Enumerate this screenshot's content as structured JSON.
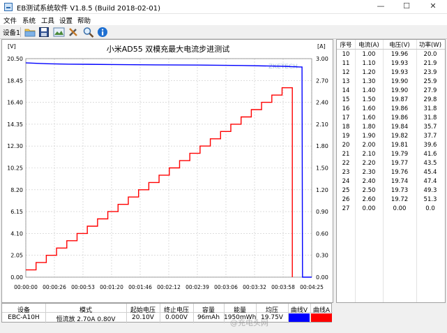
{
  "window": {
    "title": "EB测试系统软件 V1.8.5 (Build 2018-02-01)",
    "min_glyph": "—",
    "max_glyph": "☐",
    "close_glyph": "✕"
  },
  "menu": [
    "文件",
    "系统",
    "工具",
    "设置",
    "帮助"
  ],
  "toolbar": {
    "device_label": "设备1",
    "buttons": [
      "open-folder",
      "save",
      "chart-image",
      "tools",
      "search",
      "info"
    ]
  },
  "chart_data": {
    "type": "line",
    "title": "小米AD55 双模充最大电流步进测试",
    "left_axis_unit": "[V]",
    "right_axis_unit": "[A]",
    "watermark": "ZKETECH",
    "ylim_left": [
      0,
      20.5
    ],
    "ylim_right": [
      0,
      3.0
    ],
    "yticks_left": [
      "20.50",
      "18.45",
      "16.40",
      "14.35",
      "12.30",
      "10.25",
      "8.20",
      "6.15",
      "4.10",
      "2.05",
      "0.00"
    ],
    "yticks_right": [
      "3.00",
      "2.70",
      "2.40",
      "2.10",
      "1.80",
      "1.50",
      "1.20",
      "0.90",
      "0.60",
      "0.30",
      "0.00"
    ],
    "xticks": [
      "00:00:00",
      "00:00:26",
      "00:00:53",
      "00:01:20",
      "00:01:46",
      "00:02:12",
      "00:02:39",
      "00:03:06",
      "00:03:32",
      "00:03:58",
      "00:04:25"
    ],
    "x_end_seconds": 265,
    "series": [
      {
        "name": "曲线V",
        "color": "#0000ff",
        "axis": "left",
        "points": [
          [
            0,
            20.1
          ],
          [
            20,
            20.02
          ],
          [
            40,
            19.98
          ],
          [
            80,
            19.95
          ],
          [
            120,
            19.92
          ],
          [
            160,
            19.9
          ],
          [
            200,
            19.86
          ],
          [
            240,
            19.78
          ],
          [
            254,
            19.72
          ],
          [
            256,
            19.72
          ],
          [
            256.5,
            0.0
          ],
          [
            265,
            0.0
          ]
        ]
      },
      {
        "name": "曲线A",
        "color": "#ff0000",
        "axis": "right",
        "step_seconds": 9.5,
        "currents": [
          0.1,
          0.2,
          0.3,
          0.4,
          0.5,
          0.6,
          0.7,
          0.8,
          0.9,
          1.0,
          1.1,
          1.2,
          1.3,
          1.4,
          1.5,
          1.6,
          1.7,
          1.8,
          1.9,
          2.0,
          2.1,
          2.2,
          2.3,
          2.4,
          2.5,
          2.6
        ],
        "final_current": 0.0
      }
    ]
  },
  "table": {
    "headers": [
      "序号",
      "电流(A)",
      "电压(V)",
      "功率(W)"
    ],
    "rows": [
      [
        "10",
        "1.00",
        "19.96",
        "20.0"
      ],
      [
        "11",
        "1.10",
        "19.93",
        "21.9"
      ],
      [
        "12",
        "1.20",
        "19.93",
        "23.9"
      ],
      [
        "13",
        "1.30",
        "19.90",
        "25.9"
      ],
      [
        "14",
        "1.40",
        "19.90",
        "27.9"
      ],
      [
        "15",
        "1.50",
        "19.87",
        "29.8"
      ],
      [
        "16",
        "1.60",
        "19.86",
        "31.8"
      ],
      [
        "17",
        "1.60",
        "19.86",
        "31.8"
      ],
      [
        "18",
        "1.80",
        "19.84",
        "35.7"
      ],
      [
        "19",
        "1.90",
        "19.82",
        "37.7"
      ],
      [
        "20",
        "2.00",
        "19.81",
        "39.6"
      ],
      [
        "21",
        "2.10",
        "19.79",
        "41.6"
      ],
      [
        "22",
        "2.20",
        "19.77",
        "43.5"
      ],
      [
        "23",
        "2.30",
        "19.76",
        "45.4"
      ],
      [
        "24",
        "2.40",
        "19.74",
        "47.4"
      ],
      [
        "25",
        "2.50",
        "19.73",
        "49.3"
      ],
      [
        "26",
        "2.60",
        "19.72",
        "51.3"
      ],
      [
        "27",
        "0.00",
        "0.00",
        "0.0"
      ]
    ]
  },
  "status": {
    "headers": [
      "设备",
      "模式",
      "起始电压",
      "终止电压",
      "容量",
      "能量",
      "均压",
      "曲线V",
      "曲线A"
    ],
    "values": [
      "EBC-A10H",
      "恒流放 2.70A 0.80V",
      "20.10V",
      "0.000V",
      "96mAh",
      "1950mWh",
      "19.75V"
    ],
    "curve_v_color": "#0000ff",
    "curve_a_color": "#ff0000"
  },
  "footer_watermark": "@充电头网"
}
